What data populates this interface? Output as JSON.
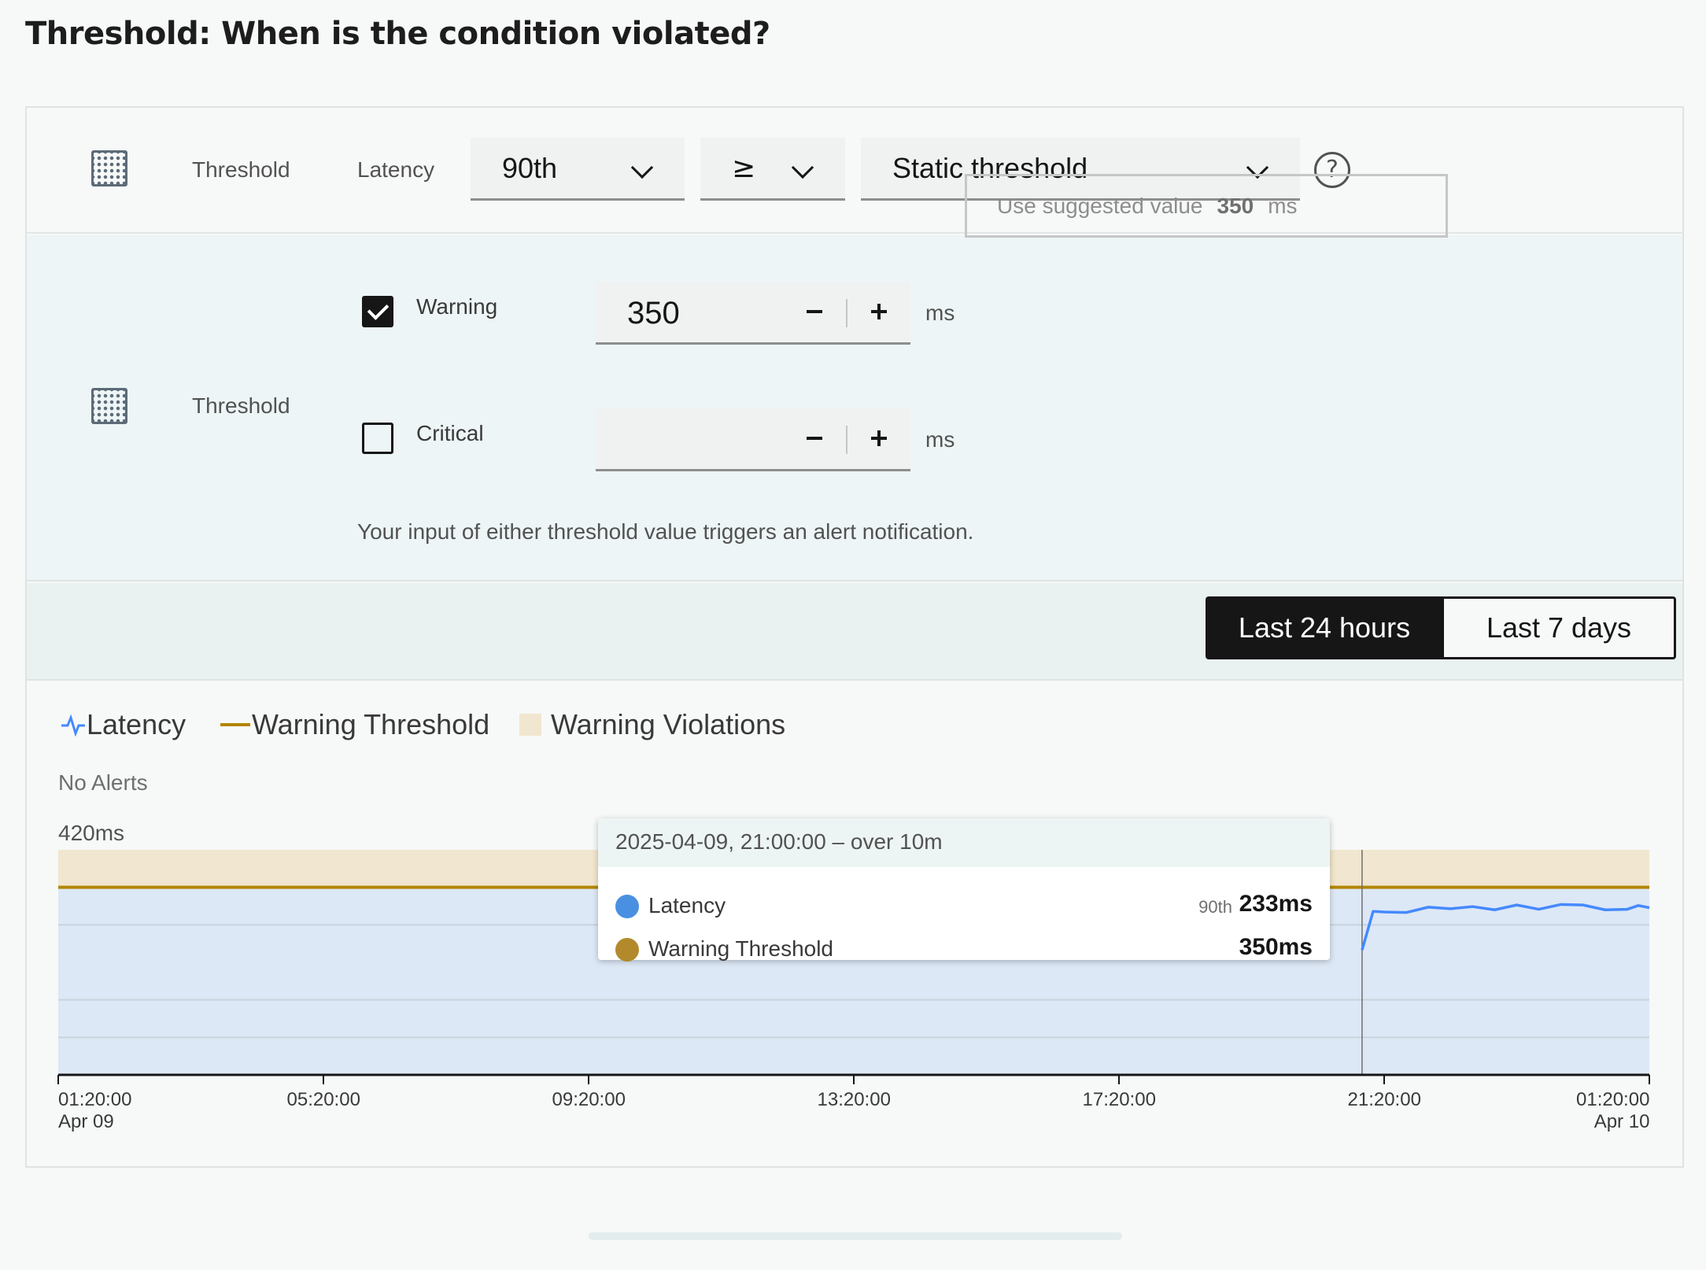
{
  "page": {
    "title": "Threshold: When is the condition violated?"
  },
  "condition_row": {
    "label": "Threshold",
    "metric_label": "Latency",
    "percentile_dropdown": "90th",
    "operator_dropdown": "≥",
    "threshold_type_dropdown": "Static threshold",
    "help_icon": "?"
  },
  "threshold_row": {
    "label": "Threshold",
    "warning": {
      "checked": true,
      "label": "Warning",
      "value": "350",
      "unit": "ms"
    },
    "critical": {
      "checked": false,
      "label": "Critical",
      "value": "",
      "unit": "ms"
    },
    "suggest": {
      "text": "Use suggested value",
      "value": "350",
      "unit": "ms"
    },
    "hint": "Your input of either threshold value triggers an alert notification."
  },
  "time_range": {
    "options": [
      "Last 24 hours",
      "Last 7 days"
    ],
    "selected": "Last 24 hours"
  },
  "legend": {
    "latency": "Latency",
    "warning_threshold": "Warning Threshold",
    "warning_violations": "Warning Violations"
  },
  "status": "No Alerts",
  "colors": {
    "latency": "#4589ff",
    "threshold": "#b28600",
    "violations": "#f1e6cf",
    "area": "#dde8f6"
  },
  "chart_data": {
    "type": "line",
    "y_max_label": "420ms",
    "ylim": [
      0,
      420
    ],
    "x_ticks": [
      {
        "time": "01:20:00",
        "date": "Apr 09"
      },
      {
        "time": "05:20:00",
        "date": ""
      },
      {
        "time": "09:20:00",
        "date": ""
      },
      {
        "time": "13:20:00",
        "date": ""
      },
      {
        "time": "17:20:00",
        "date": ""
      },
      {
        "time": "21:20:00",
        "date": ""
      },
      {
        "time": "01:20:00",
        "date": "Apr 10"
      }
    ],
    "warning_threshold": 350,
    "series": [
      {
        "name": "Latency",
        "x": [
          "2025-04-09 21:00",
          "2025-04-09 21:10",
          "2025-04-09 21:20",
          "2025-04-09 21:40",
          "2025-04-09 22:00",
          "2025-04-09 22:20",
          "2025-04-09 22:40",
          "2025-04-09 23:00",
          "2025-04-09 23:20",
          "2025-04-09 23:40",
          "2025-04-10 00:00",
          "2025-04-10 00:20",
          "2025-04-10 00:40",
          "2025-04-10 01:00",
          "2025-04-10 01:10",
          "2025-04-10 01:20"
        ],
        "values": [
          233,
          305,
          304,
          303,
          313,
          310,
          314,
          308,
          317,
          309,
          318,
          317,
          308,
          309,
          316,
          312
        ]
      }
    ],
    "tooltip": {
      "header": "2025-04-09, 21:00:00 – over 10m",
      "rows": [
        {
          "name": "Latency",
          "prefix": "90th",
          "value": "233ms"
        },
        {
          "name": "Warning Threshold",
          "prefix": "",
          "value": "350ms"
        }
      ]
    }
  }
}
